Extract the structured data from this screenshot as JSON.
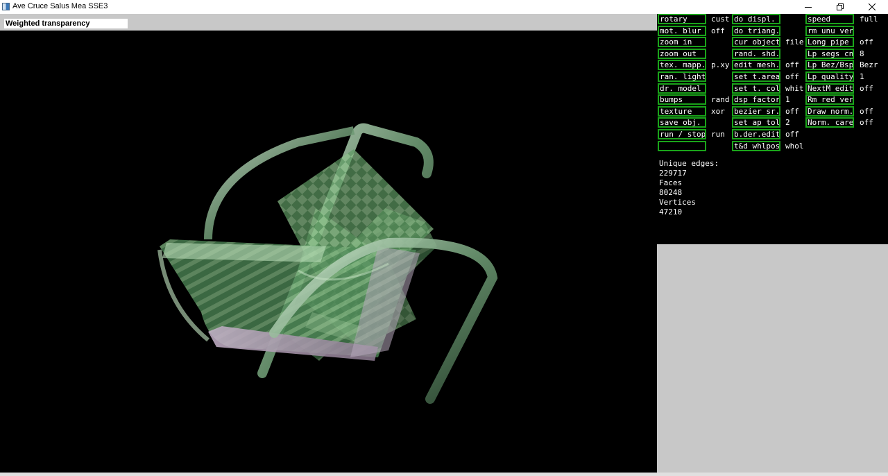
{
  "window": {
    "title": "Ave Cruce Salus Mea SSE3"
  },
  "toolbar": {
    "mode": "Weighted transparency"
  },
  "viewport": {
    "object": "3D chair model rendered with weighted transparency and checker texture"
  },
  "menu": {
    "col1": [
      {
        "label": "rotary",
        "value": "cust"
      },
      {
        "label": "mot. blur",
        "value": "off"
      },
      {
        "label": "zoom in",
        "value": ""
      },
      {
        "label": "zoom out",
        "value": ""
      },
      {
        "label": "tex. mapp.",
        "value": "p.xy"
      },
      {
        "label": "ran. light",
        "value": ""
      },
      {
        "label": "dr. model",
        "value": ""
      },
      {
        "label": "bumps",
        "value": "rand"
      },
      {
        "label": "texture",
        "value": "xor"
      },
      {
        "label": "save obj.",
        "value": ""
      },
      {
        "label": "run / stop",
        "value": "run"
      },
      {
        "label": "",
        "value": ""
      }
    ],
    "col2": [
      {
        "label": "do displ.",
        "value": ""
      },
      {
        "label": "do triang.",
        "value": ""
      },
      {
        "label": "cur object",
        "value": "file"
      },
      {
        "label": "rand. shd.",
        "value": ""
      },
      {
        "label": "edit mesh.",
        "value": "off"
      },
      {
        "label": "set t.area",
        "value": "off"
      },
      {
        "label": "set t. col",
        "value": "whit"
      },
      {
        "label": "dsp factor",
        "value": "1"
      },
      {
        "label": "bezier sr.",
        "value": "off"
      },
      {
        "label": "set ap tol",
        "value": "2"
      },
      {
        "label": "b.der.edit",
        "value": "off"
      },
      {
        "label": "t&d whlpos",
        "value": "whol"
      }
    ],
    "col3": [
      {
        "label": "speed",
        "value": "full"
      },
      {
        "label": "rm unu ver",
        "value": ""
      },
      {
        "label": "Long pipe",
        "value": "off"
      },
      {
        "label": "Lp segs cn",
        "value": "8"
      },
      {
        "label": "Lp Bez/Bsp",
        "value": "Bezr"
      },
      {
        "label": "Lp quality",
        "value": "1"
      },
      {
        "label": "NextM edit",
        "value": "off"
      },
      {
        "label": "Rm red ver",
        "value": ""
      },
      {
        "label": "Draw norm.",
        "value": "off"
      },
      {
        "label": "Norm. care",
        "value": "off"
      }
    ]
  },
  "stats": {
    "edges_label": "Unique edges:",
    "edges": "229717",
    "faces_label": "Faces",
    "faces": "80248",
    "vertices_label": "Vertices",
    "vertices": "47210"
  },
  "colors": {
    "menu_border": "#1aa41a",
    "panel_bg": "#000000",
    "viewport_bg": "#000000",
    "glass": "#6fa86f"
  }
}
